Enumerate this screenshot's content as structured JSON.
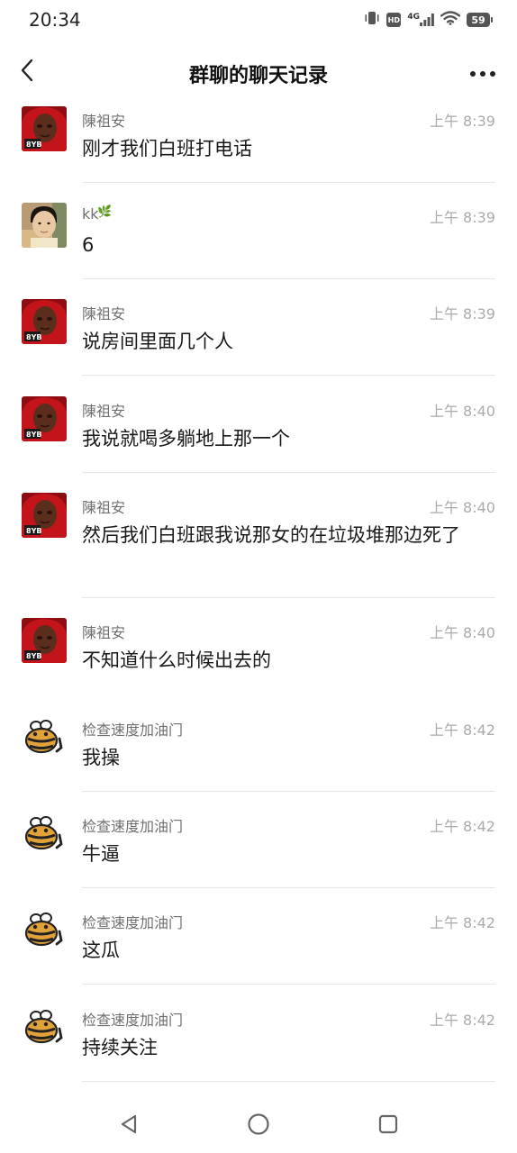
{
  "status_bar": {
    "time": "20:34",
    "network_label": "4G",
    "hd_label": "HD",
    "battery_level": "59",
    "icons": [
      "vibrate-icon",
      "hd-icon",
      "signal-icon",
      "wifi-icon",
      "battery-icon"
    ]
  },
  "nav": {
    "title": "群聊的聊天记录",
    "back_icon": "back-arrow-icon",
    "more_icon": "more-dots-icon"
  },
  "colors": {
    "sender_text": "#6f6f6f",
    "time_text": "#ababab",
    "message_text": "#191919",
    "divider": "#e6e6e6"
  },
  "messages": [
    {
      "sender": "陳祖安",
      "time": "上午 8:39",
      "text": "刚才我们白班打电话",
      "avatar": "red-hood-avatar"
    },
    {
      "sender": "kk",
      "sender_suffix": "🌿",
      "time": "上午 8:39",
      "text": "6",
      "avatar": "child-photo-avatar"
    },
    {
      "sender": "陳祖安",
      "time": "上午 8:39",
      "text": "说房间里面几个人",
      "avatar": "red-hood-avatar"
    },
    {
      "sender": "陳祖安",
      "time": "上午 8:40",
      "text": "我说就喝多躺地上那一个",
      "avatar": "red-hood-avatar"
    },
    {
      "sender": "陳祖安",
      "time": "上午 8:40",
      "text": "然后我们白班跟我说那女的在垃圾堆那边死了",
      "avatar": "red-hood-avatar"
    },
    {
      "sender": "陳祖安",
      "time": "上午 8:40",
      "text": "不知道什么时候出去的",
      "avatar": "red-hood-avatar"
    },
    {
      "sender": "检查速度加油门",
      "time": "上午 8:42",
      "text": "我操",
      "avatar": "bee-cartoon-avatar"
    },
    {
      "sender": "检查速度加油门",
      "time": "上午 8:42",
      "text": "牛逼",
      "avatar": "bee-cartoon-avatar"
    },
    {
      "sender": "检查速度加油门",
      "time": "上午 8:42",
      "text": "这瓜",
      "avatar": "bee-cartoon-avatar"
    },
    {
      "sender": "检查速度加油门",
      "time": "上午 8:42",
      "text": "持续关注",
      "avatar": "bee-cartoon-avatar"
    }
  ],
  "bottom_nav": {
    "icons": [
      "back-triangle-icon",
      "home-circle-icon",
      "recents-square-icon"
    ]
  }
}
